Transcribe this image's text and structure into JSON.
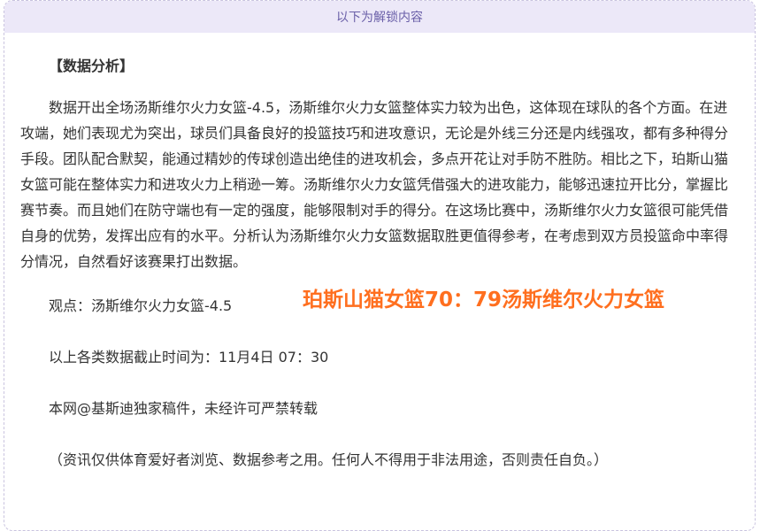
{
  "unlock_bar": {
    "text": "以下为解锁内容"
  },
  "article": {
    "heading": "【数据分析】",
    "body": "数据开出全场汤斯维尔火力女篮-4.5，汤斯维尔火力女篮整体实力较为出色，这体现在球队的各个方面。在进攻端，她们表现尤为突出，球员们具备良好的投篮技巧和进攻意识，无论是外线三分还是内线强攻，都有多种得分手段。团队配合默契，能通过精妙的传球创造出绝佳的进攻机会，多点开花让对手防不胜防。相比之下，珀斯山猫女篮可能在整体实力和进攻火力上稍逊一筹。汤斯维尔火力女篮凭借强大的进攻能力，能够迅速拉开比分，掌握比赛节奏。而且她们在防守端也有一定的强度，能够限制对手的得分。在这场比赛中，汤斯维尔火力女篮很可能凭借自身的优势，发挥出应有的水平。分析认为汤斯维尔火力女篮数据取胜更值得参考，在考虑到双方员投篮命中率得分情况，自然看好该赛果打出数据。",
    "viewpoint": "观点：汤斯维尔火力女篮-4.5",
    "deadline": "以上各类数据截止时间为：11月4日 07：30",
    "copyright": "本网@基斯迪独家稿件，未经许可严禁转载",
    "disclaimer": "（资讯仅供体育爱好者浏览、数据参考之用。任何人不得用于非法用途，否则责任自负。）"
  },
  "score_overlay": {
    "text": "珀斯山猫女篮70：79汤斯维尔火力女篮",
    "color": "#ff6f1f"
  }
}
